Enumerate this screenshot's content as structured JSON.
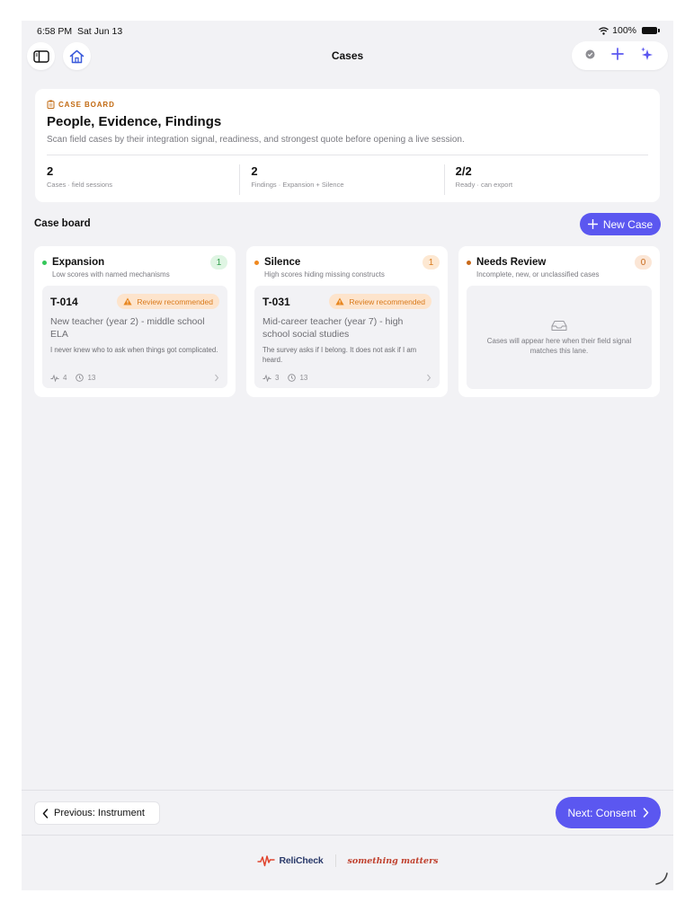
{
  "status_bar": {
    "time": "6:58 PM",
    "date": "Sat Jun 13",
    "battery": "100%"
  },
  "nav": {
    "title": "Cases"
  },
  "hero": {
    "eyebrow": "CASE BOARD",
    "title": "People, Evidence, Findings",
    "subtitle": "Scan field cases by their integration signal, readiness, and strongest quote before opening a live session.",
    "stats": [
      {
        "value": "2",
        "label": "Cases · field sessions"
      },
      {
        "value": "2",
        "label": "Findings · Expansion + Silence"
      },
      {
        "value": "2/2",
        "label": "Ready · can export"
      }
    ]
  },
  "board": {
    "title": "Case board",
    "new_case_label": "New Case"
  },
  "lanes": [
    {
      "title": "Expansion",
      "subtitle": "Low scores with named mechanisms",
      "count": "1",
      "color": "#34c759",
      "case": {
        "id": "T-014",
        "badge": "Review recommended",
        "title": "New teacher (year 2) - middle school ELA",
        "quote": "I never knew who to ask when things got complicated.",
        "signal_count": "4",
        "time_count": "13"
      }
    },
    {
      "title": "Silence",
      "subtitle": "High scores hiding missing constructs",
      "count": "1",
      "color": "#f0891f",
      "case": {
        "id": "T-031",
        "badge": "Review recommended",
        "title": "Mid-career teacher (year 7) - high school social studies",
        "quote": "The survey asks if I belong. It does not ask if I am heard.",
        "signal_count": "3",
        "time_count": "13"
      }
    },
    {
      "title": "Needs Review",
      "subtitle": "Incomplete, new, or unclassified cases",
      "count": "0",
      "color": "#c8691a",
      "empty_text": "Cases will appear here when their field signal matches this lane."
    }
  ],
  "footer": {
    "previous_label": "Previous: Instrument",
    "next_label": "Next: Consent",
    "brand_name": "ReliCheck",
    "brand_tagline": "something matters"
  },
  "colors": {
    "accent": "#5b57f0",
    "warning": "#d97a1c",
    "brand_red": "#c0412e"
  }
}
